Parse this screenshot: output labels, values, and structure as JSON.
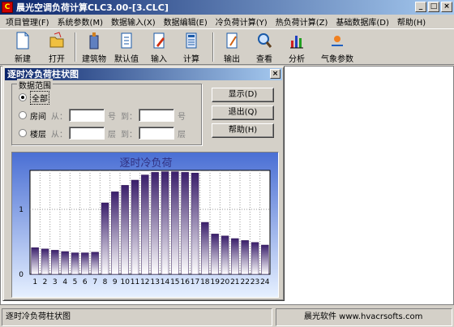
{
  "app": {
    "title": "晨光空调负荷计算CLC3.00-[3.CLC]"
  },
  "menu": [
    "项目管理(F)",
    "系统参数(M)",
    "数据输入(X)",
    "数据编辑(E)",
    "冷负荷计算(Y)",
    "热负荷计算(Z)",
    "基础数据库(D)",
    "帮助(H)"
  ],
  "toolbar": {
    "new": "新建",
    "open": "打开",
    "building": "建筑物",
    "defaults": "默认值",
    "input": "输入",
    "calc": "计算",
    "output": "输出",
    "view": "查看",
    "analyze": "分析",
    "weather": "气象参数"
  },
  "dialog": {
    "title": "逐时冷负荷柱状图",
    "range_legend": "数据范围",
    "opt_all": "全部",
    "opt_room": "房间",
    "opt_floor": "楼层",
    "from": "从：",
    "to": "到：",
    "room_unit": "号",
    "floor_unit": "层",
    "btn_show": "显示(D)",
    "btn_exit": "退出(Q)",
    "btn_help": "帮助(H)"
  },
  "status": {
    "left": "逐时冷负荷柱状图",
    "right": "晨光软件 www.hvacrsofts.com"
  },
  "colors": {
    "chart_bg_top": "#4a6fd4",
    "chart_bg_bottom": "#e6f0ff",
    "bar_top": "#3a1f6b",
    "bar_bottom": "#ffffff"
  },
  "chart_data": {
    "type": "bar",
    "title": "逐时冷负荷",
    "categories": [
      "1",
      "2",
      "3",
      "4",
      "5",
      "6",
      "7",
      "8",
      "9",
      "10",
      "11",
      "12",
      "13",
      "14",
      "15",
      "16",
      "17",
      "18",
      "19",
      "20",
      "21",
      "22",
      "23",
      "24"
    ],
    "values": [
      0.41,
      0.39,
      0.37,
      0.35,
      0.33,
      0.33,
      0.34,
      1.1,
      1.27,
      1.37,
      1.45,
      1.53,
      1.57,
      1.58,
      1.58,
      1.57,
      1.56,
      0.8,
      0.62,
      0.59,
      0.55,
      0.52,
      0.49,
      0.45
    ],
    "yticks": [
      "0",
      "1"
    ],
    "ylim": [
      0,
      1.6
    ],
    "grid": true
  }
}
